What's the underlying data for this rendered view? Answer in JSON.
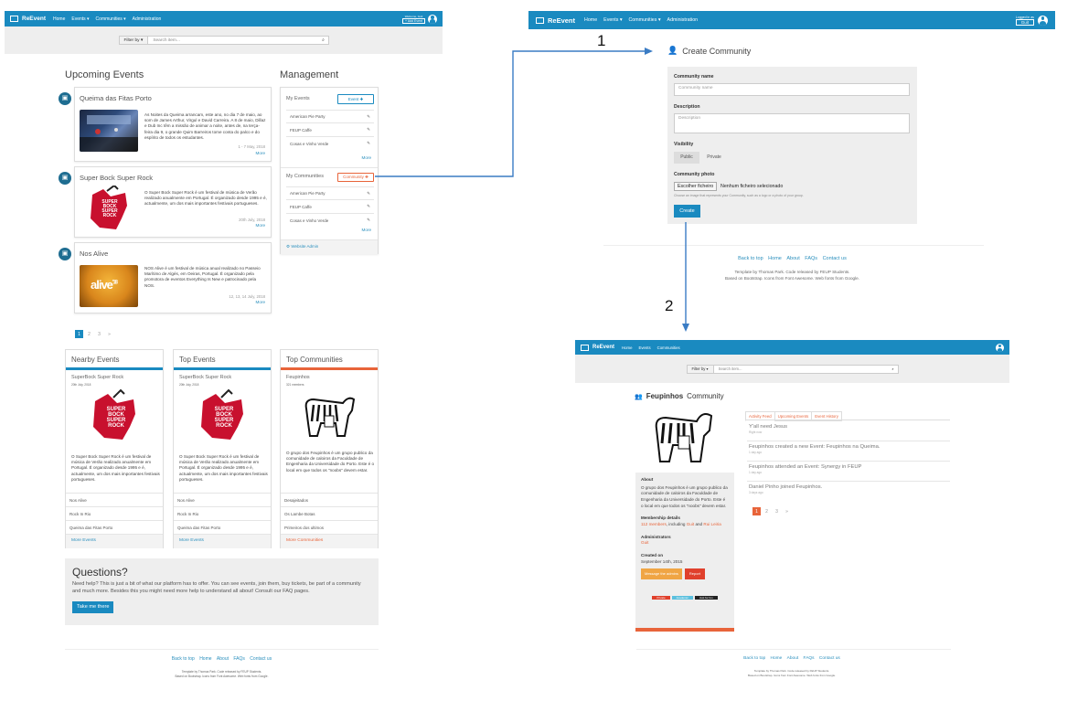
{
  "colors": {
    "brand": "#1a8ac0",
    "accent_orange": "#e8643a",
    "grey_bg": "#eee",
    "dark_blue": "#1e6d91"
  },
  "brand": "ReEvent",
  "panel_a": {
    "nav": [
      "Home",
      "Events ▾",
      "Communities ▾",
      "Administration"
    ],
    "welcome": "Welcome, Guit",
    "add_event": "+ Add Event",
    "filter": "Filter by ▾",
    "search_placeholder": "Search item...",
    "upcoming_title": "Upcoming Events",
    "events": [
      {
        "title": "Queima das Fitas Porto",
        "text": "As Noites da Queima arrancam, este ano, no dia 7 de maio, ao som de James Arthur, Virgul e David Carreira. A 8 de maio, Dillaz e Dub Inc têm a missão de animar a noite, antes de, na terça-feira dia 9, o grande Quim Barreiros tome conta do palco e do espírito de todos os estudantes.",
        "date": "1 - 7 May, 2018",
        "more": "More"
      },
      {
        "title": "Super Bock Super Rock",
        "text": "O Super Bock Super Rock é um festival de música de Verão realizado anualmente em Portugal. É organizado desde 1995 e é, actualmente, um dos mais importantes festivais portugueses.",
        "date": "20th July, 2018",
        "more": "More"
      },
      {
        "title": "Nos Alive",
        "text": "NOS Alive é um festival de música anual realizado no Passeio Marítimo de Algés, em Oeiras, Portugal. É organizado pela promotora de eventos Everything Is New e patrocinado pela NOS.",
        "date": "12, 13, 14 July, 2018",
        "more": "More"
      }
    ],
    "mgmt_title": "Management",
    "my_events": "My Events",
    "event_btn": "Event ✚",
    "my_events_list": [
      "American Pie Party",
      "FEUP Caffe",
      "Cosas e Vinho Verde"
    ],
    "my_comm": "My Communities",
    "comm_btn": "Community ✚",
    "my_comm_list": [
      "American Pie Party",
      "FEUP Caffe",
      "Cosas e Vinho Verde"
    ],
    "more": "More",
    "admin": "Website Admin",
    "pages": [
      "1",
      "2",
      "3",
      "»"
    ],
    "nearby": {
      "title": "Nearby Events",
      "item": "SuperBock Super Rock",
      "date": "20th July, 2018",
      "text": "O Super Bock Super Rock é um festival de música de Verão realizado anualmente em Portugal. É organizado desde 1995 e é, actualmente, um dos mais importantes festivais portugueses.",
      "list": [
        "Nos Alive",
        "Rock In Rio",
        "Queima das Fitas Porto"
      ],
      "more": "More Events"
    },
    "top": {
      "title": "Top Events",
      "item": "SuperBock Super Rock",
      "date": "20th July, 2018",
      "text": "O Super Bock Super Rock é um festival de música de Verão realizado anualmente em Portugal. É organizado desde 1995 e é, actualmente, um dos mais importantes festivais portugueses.",
      "list": [
        "Nos Alive",
        "Rock In Rio",
        "Queima das Fitas Porto"
      ],
      "more": "More Events"
    },
    "topcomm": {
      "title": "Top Communities",
      "item": "Feupinhos",
      "date": "321 members",
      "text": "O grupo dos Feupinhos é um grupo publico da comunidade de caloiros da Faculdade de Engenharia da Universidade do Porto. Este é o local em que todos os \"noobs\" devem estar.",
      "list": [
        "Desajeitados",
        "Os Lambe Botas",
        "Primeiros dos ultimos"
      ],
      "more": "More Communities"
    },
    "questions_title": "Questions?",
    "questions_text": "Need help? This is just a bit of what our platform has to offer. You can see events, join them, buy tickets, be part of a community and much more. Besides this you might need more help to understand all about! Consult our FAQ pages.",
    "take_me": "Take me there",
    "footer_links": [
      "Back to top",
      "Home",
      "About",
      "FAQs",
      "Contact us"
    ],
    "footer_1": "Template by Thomas Park. Code released by FEUP Students.",
    "footer_2": "Based on Bootstrap. Icons from Font Awesome. Web fonts from Google."
  },
  "panel_b": {
    "nav": [
      "Home",
      "Events ▾",
      "Communities ▾",
      "Administration"
    ],
    "logged": "Logged in as",
    "user": "Guit",
    "title": "Create Community",
    "name_label": "Community name",
    "name_ph": "Community name",
    "desc_label": "Description",
    "desc_ph": "Description",
    "vis_label": "Visibility",
    "public": "Public",
    "private": "Private",
    "photo_label": "Community photo",
    "choose": "Escolher ficheiro",
    "nofile": "Nenhum ficheiro selecionado",
    "photo_help": "Choose an image that represents your Community, such as a logo or a photo of your group.",
    "create": "Create",
    "footer_links": [
      "Back to top",
      "Home",
      "About",
      "FAQs",
      "Contact us"
    ],
    "footer_1": "Template by Thomas Park. Code released by FEUP Students.",
    "footer_2": "Based on Bootstrap. Icons from Font Awesome. Web fonts from Google."
  },
  "panel_c": {
    "nav": [
      "Home",
      "Events",
      "Communities"
    ],
    "filter": "Filter by ▾",
    "search_placeholder": "Search item...",
    "title_bold": "Feupinhos",
    "title_rest": "Community",
    "tabs": [
      "Activity Feed",
      "Upcoming Events",
      "Event History"
    ],
    "feed": [
      {
        "text": "Y'all need Jesus",
        "ago": "Right now"
      },
      {
        "text": "Feupinhos created a new Event: Feupinhos na Queima.",
        "ago": "1 day ago"
      },
      {
        "text": "Feupinhos attended an Event: Synergy in FEUP",
        "ago": "1 day ago"
      },
      {
        "text": "Daniel Pinho joined Feupinhos.",
        "ago": "3 days ago"
      }
    ],
    "pages": [
      "1",
      "2",
      "3",
      "»"
    ],
    "about_title": "About",
    "about_text": "O grupo dos Feupinhos é um grupo publico da comunidade de caloiros da Faculdade de Engenharia da Universidade do Porto. Este é o local em que todos os \"noobs\" devem estar.",
    "membership_title": "Membership details",
    "members": "112 members",
    "including": ", including",
    "guit": "Guit",
    "and": "and",
    "rui": "Rui Leiria",
    "admins_title": "Administrators",
    "admin_name": "Guit",
    "created_title": "Created on",
    "created": "September 14th, 2015",
    "msg_admins": "Message the admins",
    "report": "Report",
    "tags": [
      "Private",
      "Academic",
      "Just for fun"
    ],
    "footer_links": [
      "Back to top",
      "Home",
      "About",
      "FAQs",
      "Contact us"
    ],
    "footer_1": "Template by Thomas Park. Code released by FEUP Students.",
    "footer_2": "Based on Bootstrap. Icons from Font Awesome. Web fonts from Google."
  },
  "arrows": {
    "one": "1",
    "two": "2"
  }
}
